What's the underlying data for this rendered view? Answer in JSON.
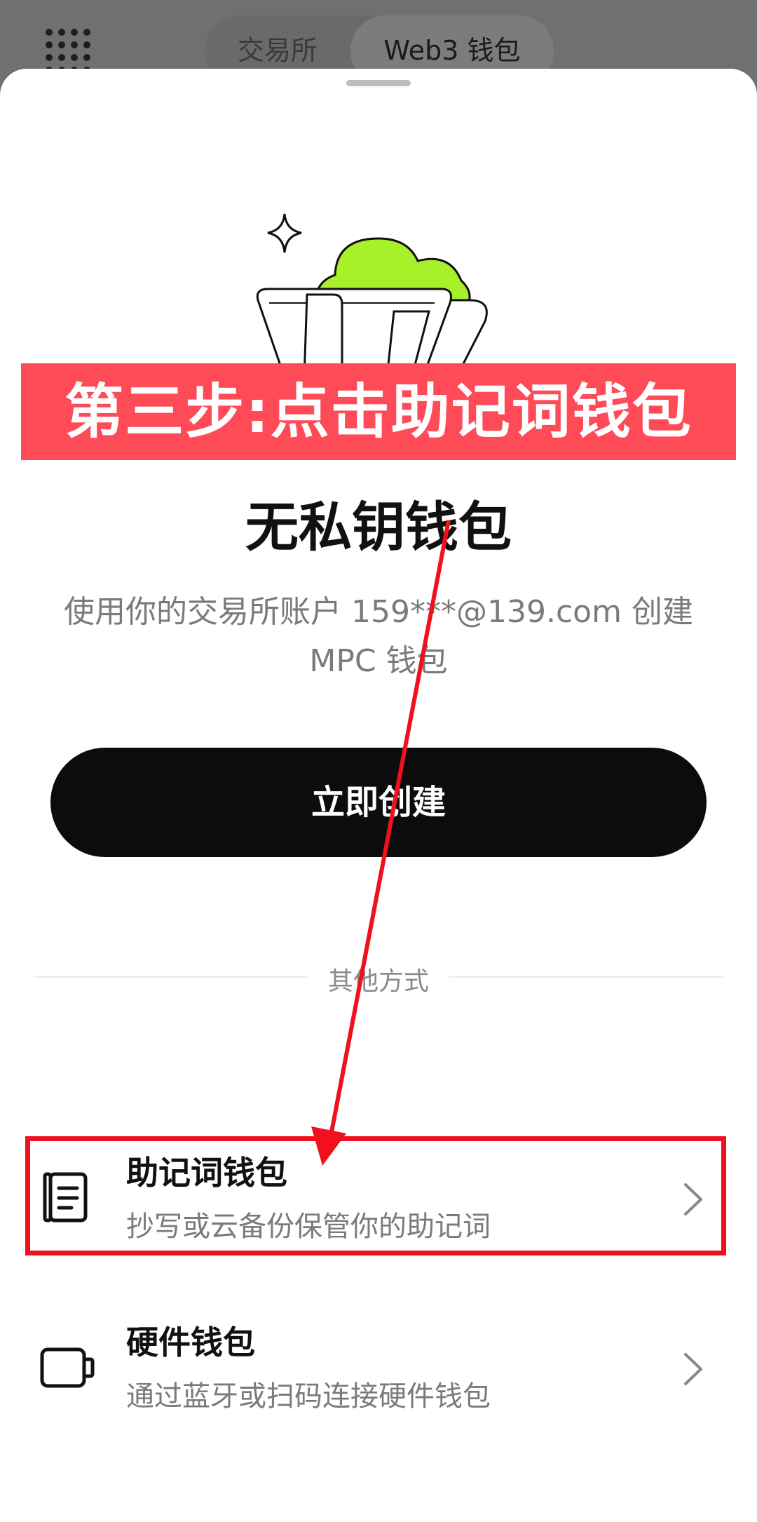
{
  "header": {
    "tabs": [
      {
        "label": "交易所"
      },
      {
        "label": "Web3 钱包"
      }
    ],
    "active_tab": "Web3 钱包"
  },
  "annotation": {
    "banner_text": "第三步:点击助记词钱包"
  },
  "main": {
    "title": "无私钥钱包",
    "description_line1": "使用你的交易所账户 159***@139.com 创建",
    "description_line2": "MPC 钱包",
    "primary_button": "立即创建",
    "divider_text": "其他方式",
    "options": [
      {
        "title": "助记词钱包",
        "subtitle": "抄写或云备份保管你的助记词",
        "icon": "notebook-icon"
      },
      {
        "title": "硬件钱包",
        "subtitle": "通过蓝牙或扫码连接硬件钱包",
        "icon": "hardware-device-icon"
      }
    ]
  },
  "colors": {
    "banner": "#ff4a57",
    "highlight": "#f0101e",
    "button": "#0c0c0c",
    "cloud": "#a8f02a"
  }
}
